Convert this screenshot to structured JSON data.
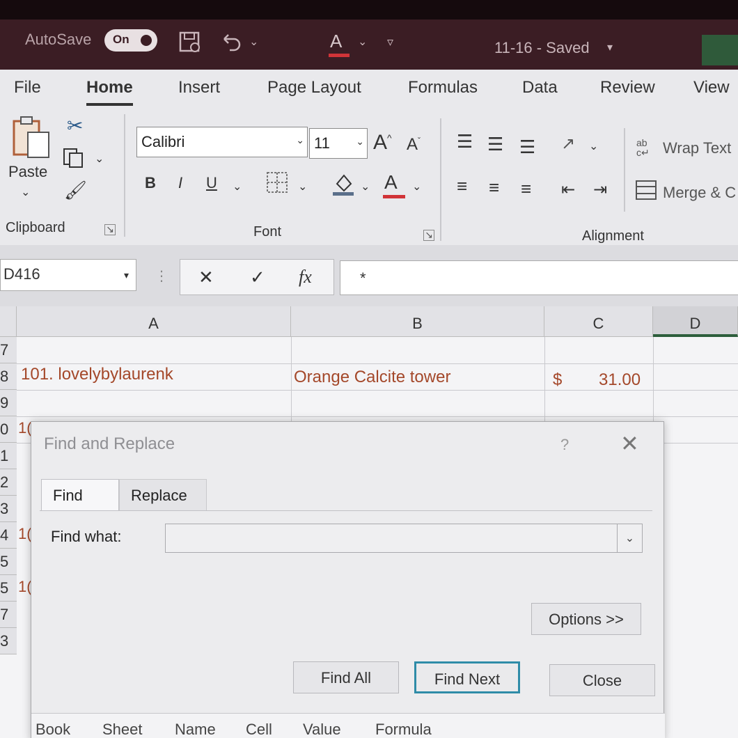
{
  "titlebar": {
    "autosave_label": "AutoSave",
    "autosave_state": "On",
    "save_icon": "save-icon",
    "undo_icon": "undo-icon",
    "font_color_icon": "A",
    "document_title": "11-16  -  Saved",
    "title_chevron": "▾",
    "accent_color": "#d13438"
  },
  "ribbon": {
    "tabs": [
      "File",
      "Home",
      "Insert",
      "Page Layout",
      "Formulas",
      "Data",
      "Review",
      "View"
    ],
    "active_tab": "Home",
    "clipboard": {
      "paste_label": "Paste",
      "group_label": "Clipboard"
    },
    "font": {
      "font_name": "Calibri",
      "font_size": "11",
      "grow_label": "A",
      "shrink_label": "A",
      "bold": "B",
      "italic": "I",
      "underline": "U",
      "font_color_label": "A",
      "group_label": "Font"
    },
    "alignment": {
      "wrap_text_label": "Wrap Text",
      "merge_label": "Merge & C",
      "group_label": "Alignment"
    }
  },
  "formula_bar": {
    "name_box": "D416",
    "cancel_label": "✕",
    "enter_label": "✓",
    "fx_label": "fx",
    "formula_value": "*"
  },
  "sheet": {
    "columns": [
      "A",
      "B",
      "C",
      "D"
    ],
    "selected_column": "D",
    "row_numbers": [
      "7",
      "8",
      "9",
      "0",
      "1",
      "2",
      "3",
      "4",
      "5",
      "5",
      "7",
      "3"
    ],
    "row8": {
      "a": "101. lovelybylaurenk",
      "b": "Orange Calcite tower",
      "c_currency": "$",
      "c_value": "31.00"
    },
    "fragments": [
      "1(",
      "1(",
      "1("
    ],
    "text_color": "#a4482a"
  },
  "dialog": {
    "title": "Find and Replace",
    "help_label": "?",
    "close_label": "✕",
    "tabs": [
      "Find",
      "Replace"
    ],
    "active_tab": "Find",
    "find_what_label": "Find what:",
    "find_what_value": "",
    "options_label": "Options >>",
    "find_all_label": "Find All",
    "find_next_label": "Find Next",
    "close_button_label": "Close",
    "results_columns": [
      "Book",
      "Sheet",
      "Name",
      "Cell",
      "Value",
      "Formula"
    ],
    "default_button_color": "#2f8ca8"
  }
}
